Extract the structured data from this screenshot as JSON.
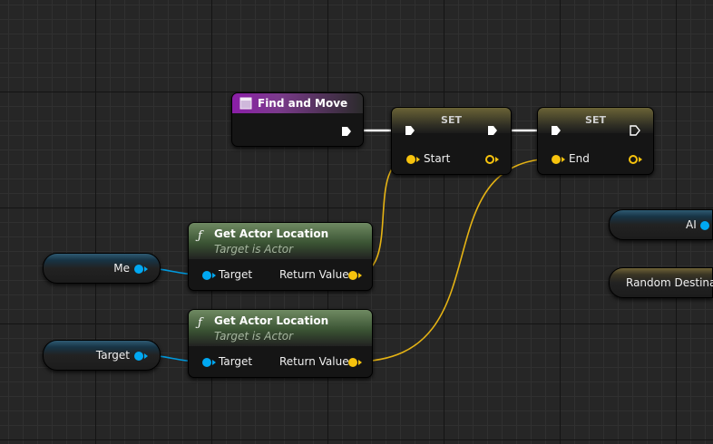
{
  "graph": {
    "event_node": {
      "title": "Find and Move"
    },
    "set_start": {
      "title": "SET",
      "pin": "Start"
    },
    "set_end": {
      "title": "SET",
      "pin": "End"
    },
    "get_location_1": {
      "title": "Get Actor Location",
      "subtitle": "Target is Actor",
      "input": "Target",
      "output": "Return Value"
    },
    "get_location_2": {
      "title": "Get Actor Location",
      "subtitle": "Target is Actor",
      "input": "Target",
      "output": "Return Value"
    },
    "var_me": {
      "label": "Me"
    },
    "var_target": {
      "label": "Target"
    },
    "var_ai": {
      "label": "AI"
    },
    "var_random_destination": {
      "label": "Random Destinati"
    }
  },
  "colors": {
    "exec": "#ffffff",
    "vector_pin": "#f7c30d",
    "object_pin": "#00a8f2",
    "event_header": "#8b1ea8",
    "function_header": "#6f8a62"
  }
}
